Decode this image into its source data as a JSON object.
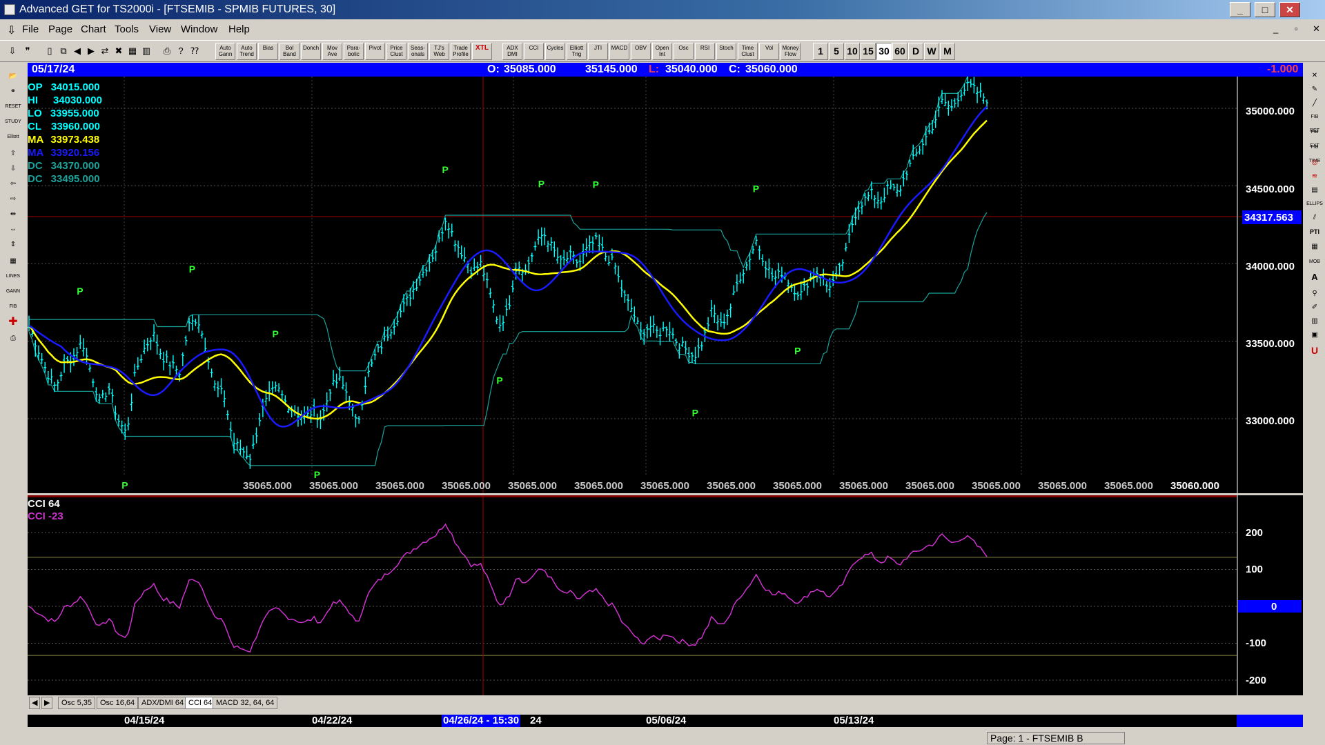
{
  "window": {
    "title": "Advanced GET for TS2000i - [FTSEMIB - SPMIB FUTURES, 30]",
    "buttons": [
      "_",
      "□",
      "✕"
    ],
    "inner_buttons": [
      "_",
      "▫",
      "✕"
    ]
  },
  "menu": [
    "File",
    "Page",
    "Chart",
    "Tools",
    "View",
    "Window",
    "Help"
  ],
  "toolbar": {
    "studies": [
      "Auto Gann",
      "Auto Trend",
      "Bias",
      "Bol Band",
      "Donch",
      "Mov Ave",
      "Para-bolic",
      "Pivot",
      "Price Clust",
      "Seas-onals",
      "TJ's Web",
      "Trade Profile",
      "XTL",
      "ADX DMI",
      "CCI",
      "Cycles",
      "Elliott Trig",
      "JTI",
      "MACD",
      "OBV",
      "Open Int",
      "Osc",
      "RSI",
      "Stoch",
      "Time Clust",
      "Vol",
      "Money Flow"
    ],
    "timeframes": [
      "1",
      "5",
      "10",
      "15",
      "30",
      "60",
      "D",
      "W",
      "M"
    ],
    "active_timeframe": "30"
  },
  "infobar": {
    "date": "05/17/24",
    "open_label": "O:",
    "open": "35085.000",
    "high": "35145.000",
    "low_label": "L:",
    "low": "35040.000",
    "close_label": "C:",
    "close": "35060.000",
    "change": "-1.000"
  },
  "price_legend": [
    {
      "label": "OP",
      "value": "34015.000",
      "color": "#00ffff"
    },
    {
      "label": "HI",
      "value": "34030.000",
      "color": "#00ffff"
    },
    {
      "label": "LO",
      "value": "33955.000",
      "color": "#00ffff"
    },
    {
      "label": "CL",
      "value": "33960.000",
      "color": "#00ffff"
    },
    {
      "label": "MA",
      "value": "33973.438",
      "color": "#ffff00"
    },
    {
      "label": "MA",
      "value": "33920.156",
      "color": "#1a1aff"
    },
    {
      "label": "DC",
      "value": "34370.000",
      "color": "#1aa39a"
    },
    {
      "label": "DC",
      "value": "33495.000",
      "color": "#1aa39a"
    }
  ],
  "price_axis": [
    "35000.000",
    "34500.000",
    "34000.000",
    "33500.000",
    "33000.000"
  ],
  "price_marker": "34317.563",
  "bottom_values": [
    "35065.000",
    "35065.000",
    "35065.000",
    "35065.000",
    "35065.000",
    "35065.000",
    "35065.000",
    "35065.000",
    "35065.000",
    "35065.000",
    "35065.000",
    "35065.000",
    "35065.000",
    "35065.000"
  ],
  "bottom_last": "35060.000",
  "cci": {
    "title": "CCI 64",
    "value_label": "CCI  -23",
    "axis": [
      "200",
      "100",
      "0",
      "-100",
      "-200"
    ],
    "zero_marker": "0"
  },
  "tabs": [
    "Osc 5,35",
    "Osc 16,64",
    "ADX/DMI 64",
    "CCI 64",
    "MACD 32, 64, 64"
  ],
  "active_tab": "CCI 64",
  "dates": {
    "d1": "04/15/24",
    "d2": "04/22/24",
    "cursor": "04/26/24 - 15:30",
    "cursor_tail": "24",
    "d4": "05/06/24",
    "d5": "05/13/24"
  },
  "status": "Page: 1 - FTSEMIB B",
  "pivot_label": "P",
  "colors": {
    "price_bars": "#00ffff",
    "ma_fast": "#ffff00",
    "ma_slow": "#1a1aff",
    "donchian": "#1aa39a",
    "cci_line": "#cc33cc",
    "pivot": "#33ff33",
    "cursor": "#a00000",
    "infobar": "#0000ff"
  },
  "chart_data": {
    "type": "line",
    "ylim": [
      32600,
      35250
    ],
    "price_path": [
      33600,
      33450,
      33300,
      33200,
      33350,
      33400,
      33500,
      33300,
      33100,
      33200,
      33000,
      32900,
      33300,
      33450,
      33550,
      33400,
      33350,
      33300,
      33600,
      33650,
      33450,
      33200,
      33150,
      32850,
      32800,
      32750,
      33000,
      33150,
      33200,
      33100,
      33050,
      33000,
      33050,
      33000,
      33200,
      33250,
      33150,
      32950,
      33250,
      33400,
      33500,
      33600,
      33700,
      33800,
      33900,
      34000,
      34100,
      34300,
      34150,
      34050,
      33950,
      34000,
      33800,
      33600,
      33700,
      34000,
      33950,
      34100,
      34200,
      34100,
      34000,
      34050,
      34000,
      34100,
      34150,
      34050,
      34000,
      33800,
      33700,
      33550,
      33600,
      33550,
      33600,
      33500,
      33450,
      33400,
      33500,
      33700,
      33600,
      33700,
      33900,
      34000,
      34150,
      34000,
      33900,
      33950,
      33850,
      33800,
      33900,
      33950,
      33850,
      33900,
      34050,
      34300,
      34400,
      34450,
      34400,
      34500,
      34450,
      34600,
      34700,
      34800,
      34900,
      35050,
      35000,
      35100,
      35150,
      35100,
      35060
    ]
  }
}
